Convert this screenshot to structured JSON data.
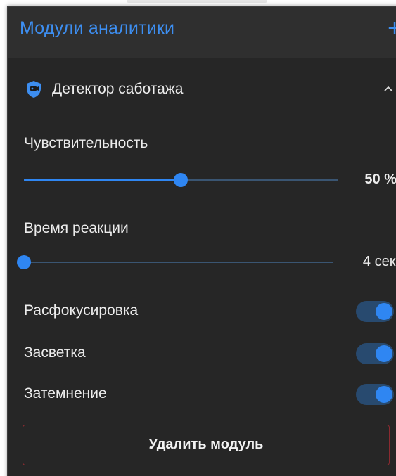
{
  "header": {
    "title": "Модули аналитики",
    "add_icon": "+"
  },
  "module": {
    "title": "Детектор саботажа",
    "icon": "shield-camera-icon",
    "expanded": true
  },
  "settings": {
    "sensitivity": {
      "label": "Чувствительность",
      "value_text": "50 %",
      "fraction": 0.5
    },
    "reaction_time": {
      "label": "Время реакции",
      "value_text": "4 сек.",
      "fraction": 0.0
    },
    "toggles": [
      {
        "label": "Расфокусировка",
        "on": true
      },
      {
        "label": "Засветка",
        "on": true
      },
      {
        "label": "Затемнение",
        "on": true
      }
    ]
  },
  "actions": {
    "delete_label": "Удалить модуль"
  },
  "colors": {
    "accent": "#2f86f2",
    "panel_bg": "#262626",
    "header_bg": "#2f2f2f",
    "danger_border": "#8b2a30",
    "text": "#ececec"
  }
}
